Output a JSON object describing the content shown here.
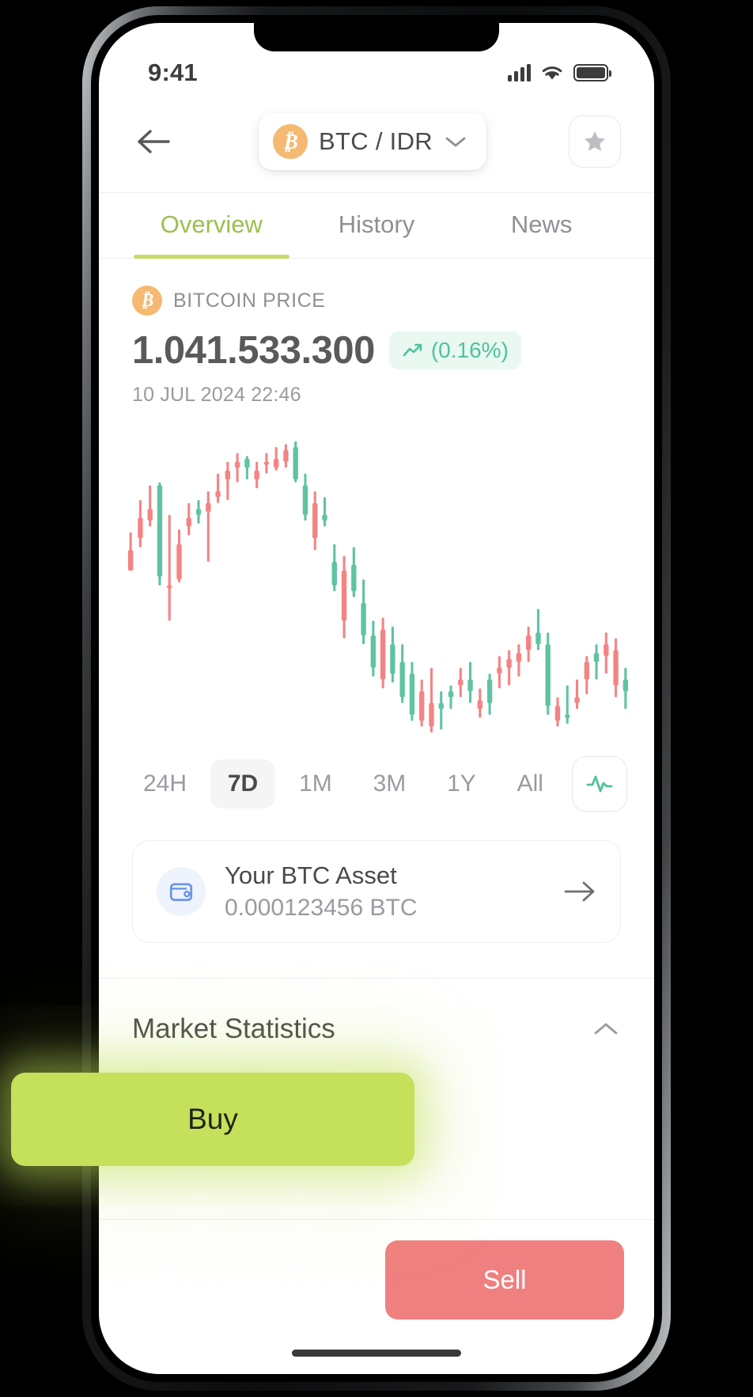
{
  "status_bar": {
    "time": "9:41",
    "signal_icon": "cellular-bars-icon",
    "wifi_icon": "wifi-icon",
    "battery_icon": "battery-icon"
  },
  "header": {
    "back_icon": "arrow-left-icon",
    "pair_symbol": "₿",
    "pair_label": "BTC / IDR",
    "chevron_icon": "chevron-down-icon",
    "favorite_icon": "star-icon"
  },
  "tabs": [
    {
      "label": "Overview",
      "active": true
    },
    {
      "label": "History",
      "active": false
    },
    {
      "label": "News",
      "active": false
    }
  ],
  "price": {
    "coin_symbol": "₿",
    "label": "BITCOIN PRICE",
    "value": "1.041.533.300",
    "change": "(0.16%)",
    "change_icon": "trending-up-icon",
    "timestamp": "10 JUL 2024 22:46"
  },
  "colors": {
    "accent_green": "#c3dd6a",
    "buy_green": "#c5e05a",
    "sell_red": "#F08080",
    "candle_up": "#5FC3A1",
    "candle_down": "#F48484",
    "bitcoin_orange": "#F5B971",
    "change_text": "#4fc39a",
    "wallet_blue": "#6b93e8"
  },
  "ranges": [
    {
      "label": "24H",
      "active": false
    },
    {
      "label": "7D",
      "active": true
    },
    {
      "label": "1M",
      "active": false
    },
    {
      "label": "3M",
      "active": false
    },
    {
      "label": "1Y",
      "active": false
    },
    {
      "label": "All",
      "active": false
    }
  ],
  "chart_type_button": {
    "icon": "activity-pulse-icon"
  },
  "asset_card": {
    "icon": "wallet-icon",
    "title": "Your BTC Asset",
    "amount": "0.000123456 BTC",
    "arrow_icon": "arrow-right-icon"
  },
  "market_statistics": {
    "title": "Market Statistics",
    "chevron_icon": "chevron-up-icon"
  },
  "actions": {
    "buy_label": "Buy",
    "sell_label": "Sell"
  },
  "chart_data": {
    "type": "candlestick",
    "title": "BTC / IDR price",
    "timeframe": "7D",
    "xlabel": "",
    "ylabel": "",
    "grid": false,
    "legend": false,
    "ylim": [
      0,
      100
    ],
    "candles": [
      {
        "o": 62,
        "h": 68,
        "l": 55,
        "c": 55,
        "dir": "down"
      },
      {
        "o": 73,
        "h": 79,
        "l": 63,
        "c": 66,
        "dir": "down"
      },
      {
        "o": 76,
        "h": 84,
        "l": 70,
        "c": 72,
        "dir": "down"
      },
      {
        "o": 53,
        "h": 85,
        "l": 50,
        "c": 84,
        "dir": "up"
      },
      {
        "o": 49,
        "h": 74,
        "l": 38,
        "c": 50,
        "dir": "down"
      },
      {
        "o": 64,
        "h": 69,
        "l": 51,
        "c": 52,
        "dir": "down"
      },
      {
        "o": 73,
        "h": 78,
        "l": 67,
        "c": 70,
        "dir": "down"
      },
      {
        "o": 74,
        "h": 79,
        "l": 71,
        "c": 76,
        "dir": "up"
      },
      {
        "o": 78,
        "h": 82,
        "l": 58,
        "c": 75,
        "dir": "down"
      },
      {
        "o": 82,
        "h": 88,
        "l": 78,
        "c": 80,
        "dir": "down"
      },
      {
        "o": 86,
        "h": 92,
        "l": 79,
        "c": 89,
        "dir": "down"
      },
      {
        "o": 92,
        "h": 95,
        "l": 85,
        "c": 90,
        "dir": "down"
      },
      {
        "o": 90,
        "h": 94,
        "l": 86,
        "c": 93,
        "dir": "up"
      },
      {
        "o": 89,
        "h": 92,
        "l": 83,
        "c": 86,
        "dir": "down"
      },
      {
        "o": 91,
        "h": 95,
        "l": 88,
        "c": 92,
        "dir": "down"
      },
      {
        "o": 93,
        "h": 97,
        "l": 89,
        "c": 90,
        "dir": "down"
      },
      {
        "o": 96,
        "h": 98,
        "l": 90,
        "c": 92,
        "dir": "down"
      },
      {
        "o": 97,
        "h": 99,
        "l": 85,
        "c": 86,
        "dir": "up"
      },
      {
        "o": 84,
        "h": 88,
        "l": 72,
        "c": 74,
        "dir": "up"
      },
      {
        "o": 78,
        "h": 82,
        "l": 62,
        "c": 66,
        "dir": "down"
      },
      {
        "o": 74,
        "h": 80,
        "l": 70,
        "c": 72,
        "dir": "up"
      },
      {
        "o": 58,
        "h": 64,
        "l": 48,
        "c": 50,
        "dir": "up"
      },
      {
        "o": 55,
        "h": 60,
        "l": 32,
        "c": 38,
        "dir": "down"
      },
      {
        "o": 57,
        "h": 63,
        "l": 46,
        "c": 48,
        "dir": "up"
      },
      {
        "o": 44,
        "h": 52,
        "l": 30,
        "c": 33,
        "dir": "up"
      },
      {
        "o": 33,
        "h": 38,
        "l": 19,
        "c": 22,
        "dir": "up"
      },
      {
        "o": 35,
        "h": 39,
        "l": 15,
        "c": 18,
        "dir": "down"
      },
      {
        "o": 30,
        "h": 36,
        "l": 17,
        "c": 20,
        "dir": "up"
      },
      {
        "o": 24,
        "h": 30,
        "l": 10,
        "c": 12,
        "dir": "up"
      },
      {
        "o": 20,
        "h": 24,
        "l": 4,
        "c": 6,
        "dir": "up"
      },
      {
        "o": 14,
        "h": 18,
        "l": 2,
        "c": 4,
        "dir": "down"
      },
      {
        "o": 10,
        "h": 22,
        "l": 0,
        "c": 2,
        "dir": "down"
      },
      {
        "o": 8,
        "h": 14,
        "l": 1,
        "c": 10,
        "dir": "up"
      },
      {
        "o": 12,
        "h": 16,
        "l": 8,
        "c": 14,
        "dir": "up"
      },
      {
        "o": 16,
        "h": 22,
        "l": 12,
        "c": 18,
        "dir": "down"
      },
      {
        "o": 18,
        "h": 24,
        "l": 10,
        "c": 14,
        "dir": "up"
      },
      {
        "o": 11,
        "h": 15,
        "l": 5,
        "c": 8,
        "dir": "down"
      },
      {
        "o": 10,
        "h": 20,
        "l": 6,
        "c": 18,
        "dir": "up"
      },
      {
        "o": 20,
        "h": 26,
        "l": 15,
        "c": 22,
        "dir": "down"
      },
      {
        "o": 22,
        "h": 28,
        "l": 16,
        "c": 25,
        "dir": "down"
      },
      {
        "o": 24,
        "h": 30,
        "l": 19,
        "c": 27,
        "dir": "down"
      },
      {
        "o": 28,
        "h": 36,
        "l": 24,
        "c": 33,
        "dir": "down"
      },
      {
        "o": 34,
        "h": 42,
        "l": 28,
        "c": 30,
        "dir": "up"
      },
      {
        "o": 30,
        "h": 34,
        "l": 6,
        "c": 9,
        "dir": "up"
      },
      {
        "o": 9,
        "h": 12,
        "l": 2,
        "c": 4,
        "dir": "down"
      },
      {
        "o": 6,
        "h": 16,
        "l": 3,
        "c": 5,
        "dir": "up"
      },
      {
        "o": 12,
        "h": 18,
        "l": 8,
        "c": 10,
        "dir": "down"
      },
      {
        "o": 18,
        "h": 26,
        "l": 13,
        "c": 24,
        "dir": "down"
      },
      {
        "o": 24,
        "h": 30,
        "l": 18,
        "c": 27,
        "dir": "up"
      },
      {
        "o": 26,
        "h": 34,
        "l": 20,
        "c": 30,
        "dir": "down"
      },
      {
        "o": 28,
        "h": 32,
        "l": 12,
        "c": 16,
        "dir": "down"
      },
      {
        "o": 14,
        "h": 22,
        "l": 8,
        "c": 18,
        "dir": "up"
      }
    ]
  }
}
